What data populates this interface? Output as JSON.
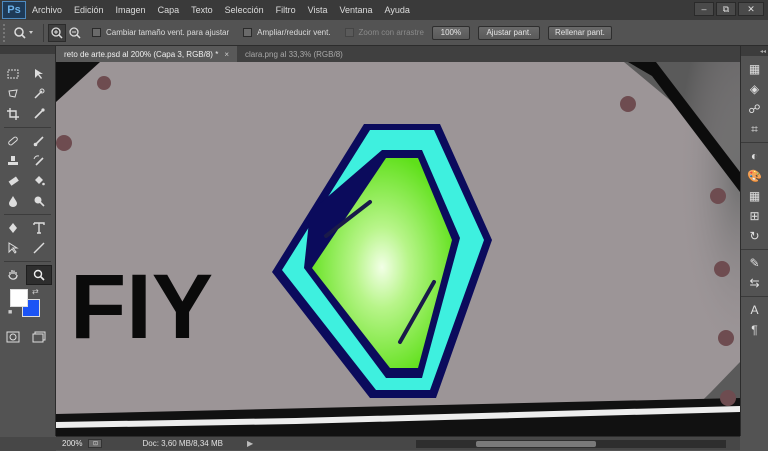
{
  "app": {
    "logo": "Ps"
  },
  "menu": [
    "Archivo",
    "Edición",
    "Imagen",
    "Capa",
    "Texto",
    "Selección",
    "Filtro",
    "Vista",
    "Ventana",
    "Ayuda"
  ],
  "window_controls": {
    "minimize": "–",
    "restore": "⧉",
    "close": "✕"
  },
  "options": {
    "resize_windows_label": "Cambiar tamaño vent. para ajustar",
    "zoom_all_windows_label": "Ampliar/reducir vent.",
    "scrubby_zoom_label": "Zoom con arrastre",
    "btn_100": "100%",
    "btn_fit_screen": "Ajustar pant.",
    "btn_fill_screen": "Rellenar pant."
  },
  "tabs": [
    {
      "label": "reto de arte.psd al 200% (Capa 3, RGB/8) *",
      "close": "×"
    },
    {
      "label": "clara.png al 33,3% (RGB/8)"
    }
  ],
  "canvas_text": "FIY",
  "status": {
    "zoom": "200%",
    "doc": "Doc: 3,60 MB/8,34 MB",
    "arrow": "▶"
  },
  "colors": {
    "foreground": "#ffffff",
    "background": "#1b53f5",
    "gem_green": "#5fe01a",
    "gem_outline": "#3df2e0"
  }
}
